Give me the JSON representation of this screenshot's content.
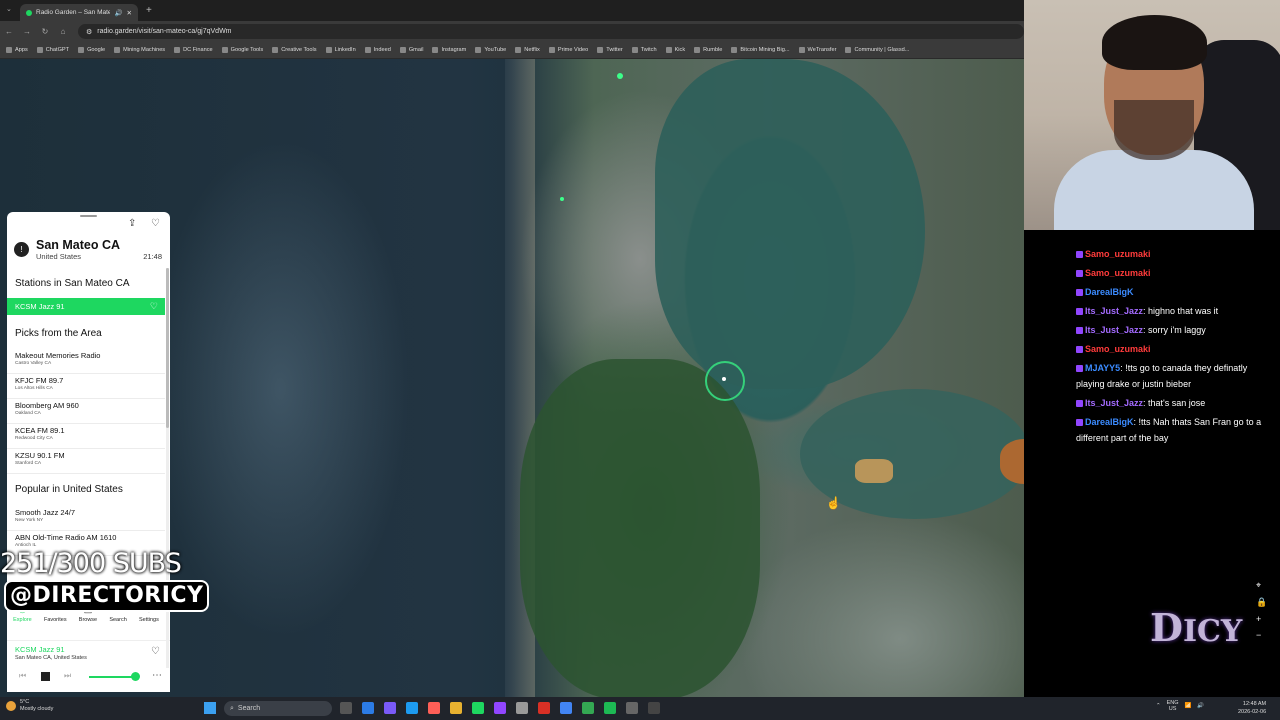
{
  "browser": {
    "tab_title": "Radio Garden – San Mateo",
    "url": "radio.garden/visit/san-mateo-ca/gj7qVdWm",
    "bookmarks": [
      "Apps",
      "ChatGPT",
      "Google",
      "Mining Machines",
      "DC Finance",
      "Google Tools",
      "Creative Tools",
      "LinkedIn",
      "Indeed",
      "Gmail",
      "Instagram",
      "YouTube",
      "Netflix",
      "Prime Video",
      "Twitter",
      "Twitch",
      "Kick",
      "Rumble",
      "Bitcoin Mining Big...",
      "WeTransfer",
      "Community | Glassd..."
    ]
  },
  "panel": {
    "city": "San Mateo CA",
    "country": "United States",
    "local_time": "21:48",
    "stations_title": "Stations in San Mateo CA",
    "active_station": "KCSM Jazz 91",
    "picks_title": "Picks from the Area",
    "picks": [
      {
        "name": "Makeout Memories Radio",
        "place": "Castro Valley CA"
      },
      {
        "name": "KFJC FM 89.7",
        "place": "Los Altos Hills CA"
      },
      {
        "name": "Bloomberg AM 960",
        "place": "Oakland CA"
      },
      {
        "name": "KCEA FM 89.1",
        "place": "Redwood City CA"
      },
      {
        "name": "KZSU 90.1 FM",
        "place": "Stanford CA"
      }
    ],
    "popular_title": "Popular in United States",
    "popular": [
      {
        "name": "Smooth Jazz 24/7",
        "place": "New York NY"
      },
      {
        "name": "ABN Old-Time Radio AM 1610",
        "place": "Antioch IL"
      }
    ],
    "nav": [
      "Explore",
      "Favorites",
      "Browse",
      "Search",
      "Settings"
    ],
    "player_station": "KCSM Jazz 91",
    "player_location": "San Mateo CA, United States",
    "volume_percent": 92
  },
  "overlay": {
    "subs": "251/300 SUBS",
    "handle": "@DIRECTORICY"
  },
  "chat": [
    {
      "user": "Samo_uzumaki",
      "text": "",
      "color": "#ff3b3b"
    },
    {
      "user": "Samo_uzumaki",
      "text": "",
      "color": "#ff3b3b"
    },
    {
      "user": "DarealBigK",
      "text": "",
      "color": "#3b8bff"
    },
    {
      "user": "Its_Just_Jazz",
      "text": ": highno that was it",
      "color": "#a46bff"
    },
    {
      "user": "Its_Just_Jazz",
      "text": ": sorry i'm laggy",
      "color": "#a46bff"
    },
    {
      "user": "Samo_uzumaki",
      "text": "",
      "color": "#ff3b3b"
    },
    {
      "user": "MJAYY5",
      "text": ": !tts go to canada they definatly playing drake or justin bieber",
      "color": "#3b8bff"
    },
    {
      "user": "Its_Just_Jazz",
      "text": ": that's san jose",
      "color": "#a46bff"
    },
    {
      "user": "DarealBigK",
      "text": ": !tts Nah thats San Fran go to a different part of the bay",
      "color": "#3b8bff"
    }
  ],
  "taskbar": {
    "weather_temp": "5°C",
    "weather_desc": "Mostly cloudy",
    "search_placeholder": "Search",
    "lang_top": "ENG",
    "lang_bottom": "US",
    "time": "12:48 AM",
    "date": "2026-02-06"
  },
  "colors": {
    "accent": "#1ed760",
    "chat_red": "#ff3b3b",
    "chat_blue": "#3b8bff",
    "chat_purple": "#a46bff"
  }
}
